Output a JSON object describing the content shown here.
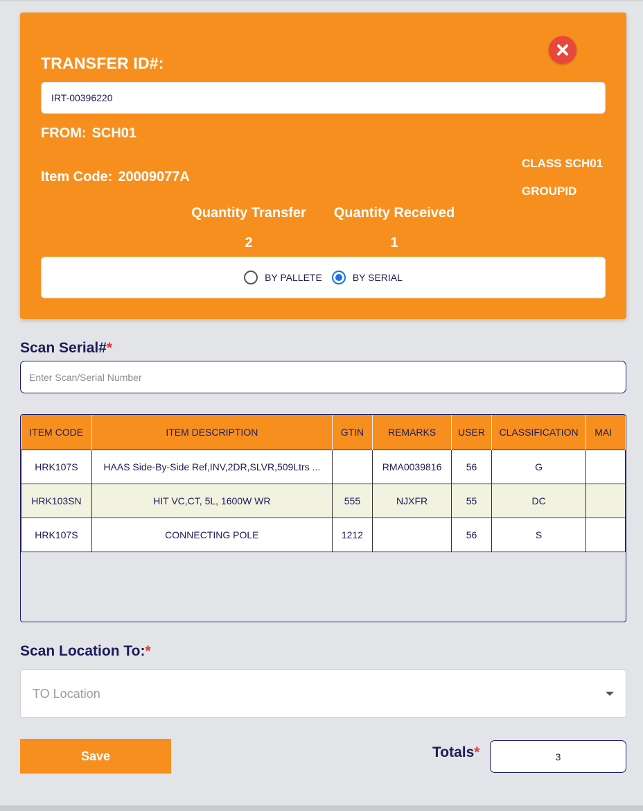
{
  "transfer": {
    "label": "TRANSFER ID#:",
    "value": "IRT-00396220"
  },
  "from": {
    "label": "FROM:",
    "value": "SCH01"
  },
  "item_code": {
    "label": "Item Code:",
    "value": "20009077A"
  },
  "class_text": "CLASS SCH01",
  "group_text": "GROUPID",
  "quantity": {
    "transfer_label": "Quantity Transfer",
    "transfer_value": "2",
    "received_label": "Quantity Received",
    "received_value": "1"
  },
  "mode": {
    "options": [
      "BY PALLETE",
      "BY SERIAL"
    ],
    "selected": "BY SERIAL"
  },
  "scan_serial": {
    "label": "Scan Serial#",
    "required_mark": "*",
    "placeholder": "Enter Scan/Serial Number"
  },
  "table": {
    "columns": [
      "ITEM CODE",
      "ITEM DESCRIPTION",
      "GTIN",
      "REMARKS",
      "USER",
      "CLASSIFICATION",
      "MAI"
    ],
    "rows": [
      [
        "HRK107S",
        "HAAS Side-By-Side Ref,INV,2DR,SLVR,509Ltrs ...",
        "",
        "RMA0039816",
        "56",
        "G",
        ""
      ],
      [
        "HRK103SN",
        "HIT VC,CT, 5L, 1600W WR",
        "555",
        "NJXFR",
        "55",
        "DC",
        ""
      ],
      [
        "HRK107S",
        "CONNECTING POLE",
        "1212",
        "",
        "56",
        "S",
        ""
      ]
    ]
  },
  "scan_location": {
    "label": "Scan Location To:",
    "required_mark": "*",
    "placeholder": "TO Location"
  },
  "save_label": "Save",
  "totals": {
    "label": "Totals",
    "required_mark": "*",
    "value": "3"
  },
  "colors": {
    "accent": "#f78f1e",
    "navy": "#1c1c5a",
    "close": "#e8473a",
    "radio": "#1a73e8"
  },
  "icons": {
    "close": "close-icon",
    "dropdown": "caret-down-icon"
  }
}
